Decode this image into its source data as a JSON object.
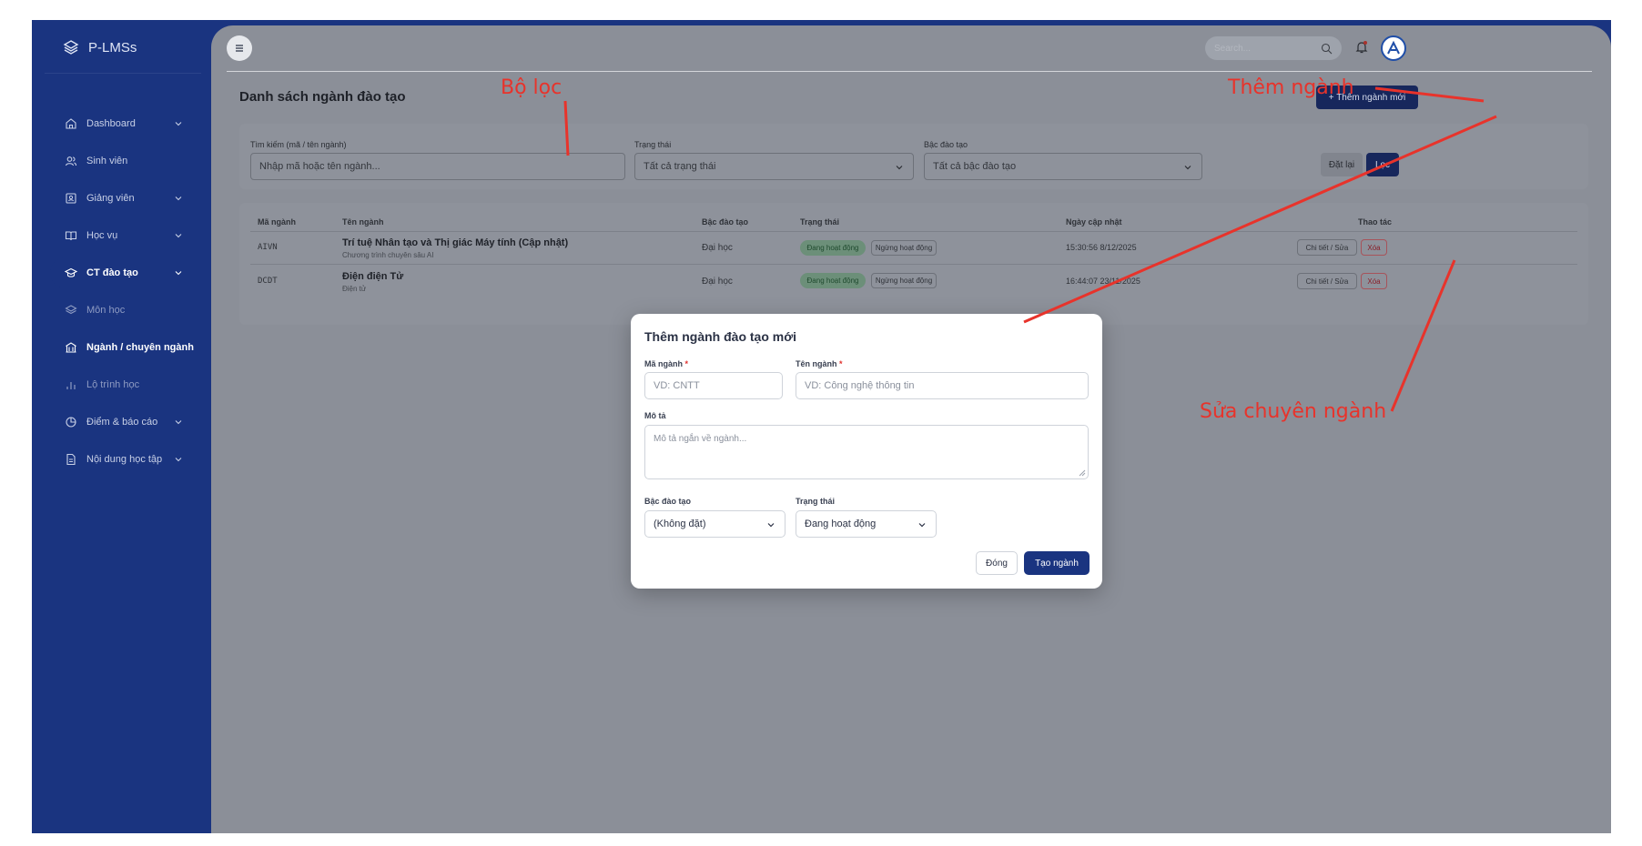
{
  "app": {
    "name": "P-LMSs"
  },
  "sidebar": {
    "items": [
      {
        "label": "Dashboard",
        "icon": "home-icon",
        "has_chevron": true
      },
      {
        "label": "Sinh viên",
        "icon": "users-icon",
        "has_chevron": false
      },
      {
        "label": "Giảng viên",
        "icon": "id-card-icon",
        "has_chevron": true
      },
      {
        "label": "Học vụ",
        "icon": "book-icon",
        "has_chevron": true
      },
      {
        "label": "CT đào tạo",
        "icon": "graduation-cap-icon",
        "has_chevron": true
      },
      {
        "label": "Môn học",
        "icon": "layers-icon"
      },
      {
        "label": "Ngành / chuyên ngành",
        "icon": "building-icon"
      },
      {
        "label": "Lộ trình học",
        "icon": "bar-chart-icon"
      },
      {
        "label": "Điểm & báo cáo",
        "icon": "pie-chart-icon",
        "has_chevron": true
      },
      {
        "label": "Nội dung học tập",
        "icon": "file-icon",
        "has_chevron": true
      }
    ]
  },
  "header": {
    "search_placeholder": "Search..."
  },
  "page": {
    "title": "Danh sách ngành đào tạo",
    "add_button": "+ Thêm ngành mới"
  },
  "filters": {
    "search_label": "Tìm kiếm (mã / tên ngành)",
    "search_placeholder": "Nhập mã hoặc tên ngành...",
    "status_label": "Trạng thái",
    "status_value": "Tất cả trạng thái",
    "level_label": "Bậc đào tạo",
    "level_value": "Tất cả bậc đào tạo",
    "reset_button": "Đặt lại",
    "filter_button": "Lọc"
  },
  "table": {
    "columns": [
      "Mã ngành",
      "Tên ngành",
      "Bậc đào tạo",
      "Trạng thái",
      "Ngày cập nhật",
      "Thao tác"
    ],
    "rows": [
      {
        "code": "AIVN",
        "name": "Trí tuệ Nhân tạo và Thị giác Máy tính (Cập nhật)",
        "desc": "Chương trình chuyên sâu AI",
        "level": "Đại học",
        "status": "Đang hoạt động",
        "status_alt": "Ngừng hoạt động",
        "updated": "15:30:56 8/12/2025",
        "edit": "Chi tiết / Sửa",
        "delete": "Xóa"
      },
      {
        "code": "DCDT",
        "name": "Điện điện Tử",
        "desc": "Điện tử",
        "level": "Đại học",
        "status": "Đang hoạt động",
        "status_alt": "Ngừng hoạt động",
        "updated": "16:44:07 23/11/2025",
        "edit": "Chi tiết / Sửa",
        "delete": "Xóa"
      }
    ]
  },
  "modal": {
    "title": "Thêm ngành đào tạo mới",
    "code_label": "Mã ngành",
    "code_placeholder": "VD: CNTT",
    "name_label": "Tên ngành",
    "name_placeholder": "VD: Công nghệ thông tin",
    "required_mark": "*",
    "desc_label": "Mô tả",
    "desc_placeholder": "Mô tả ngắn về ngành...",
    "level_label": "Bậc đào tạo",
    "level_value": "(Không đặt)",
    "status_label": "Trạng thái",
    "status_value": "Đang hoạt động",
    "close_button": "Đóng",
    "create_button": "Tạo ngành"
  },
  "annotations": {
    "filter": "Bộ lọc",
    "add": "Thêm ngành",
    "edit": "Sửa chuyên ngành"
  },
  "colors": {
    "sidebar": "#1a3480",
    "primary": "#1a3480",
    "annotation": "#e8332b",
    "danger": "#e0312d"
  }
}
